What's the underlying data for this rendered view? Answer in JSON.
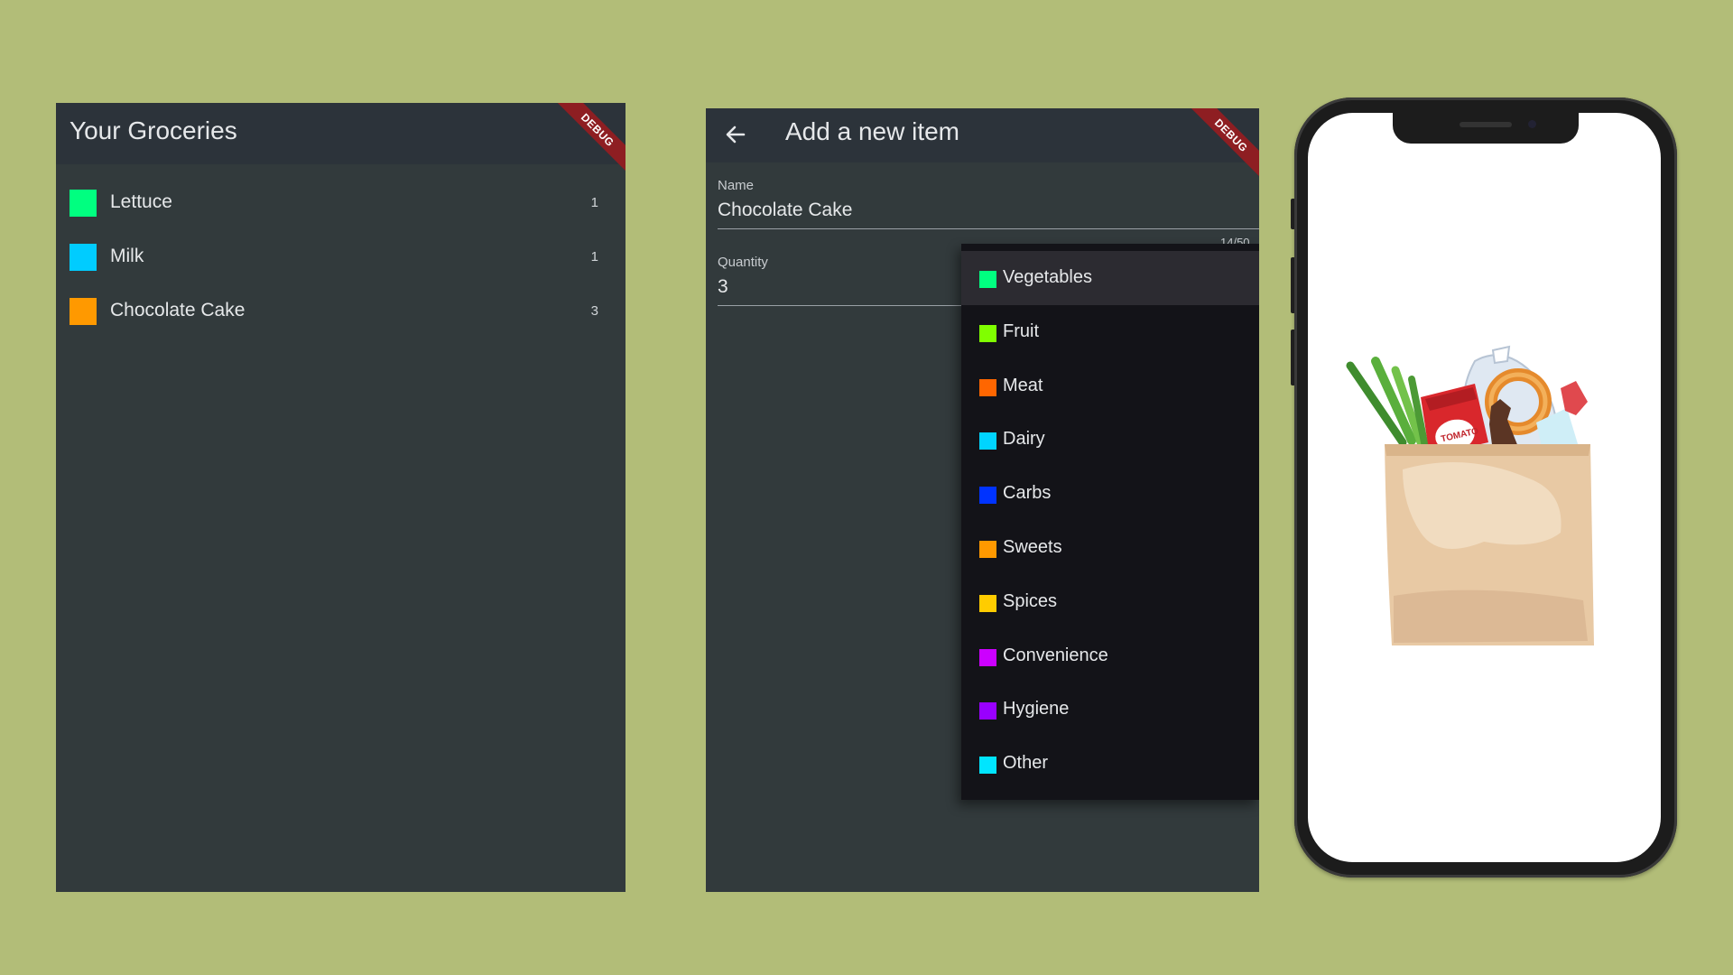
{
  "list_screen": {
    "title": "Your Groceries",
    "debug_label": "DEBUG",
    "items": [
      {
        "name": "Lettuce",
        "quantity": "1",
        "color": "#00ff80"
      },
      {
        "name": "Milk",
        "quantity": "1",
        "color": "#00ccff"
      },
      {
        "name": "Chocolate Cake",
        "quantity": "3",
        "color": "#ff9900"
      }
    ]
  },
  "form_screen": {
    "title": "Add a new item",
    "debug_label": "DEBUG",
    "name_field": {
      "label": "Name",
      "value": "Chocolate Cake",
      "counter": "14/50"
    },
    "quantity_field": {
      "label": "Quantity",
      "value": "3"
    },
    "categories": [
      {
        "label": "Vegetables",
        "color": "#00ff80",
        "selected": true
      },
      {
        "label": "Fruit",
        "color": "#80ff00"
      },
      {
        "label": "Meat",
        "color": "#ff6600"
      },
      {
        "label": "Dairy",
        "color": "#00d4ff"
      },
      {
        "label": "Carbs",
        "color": "#0033ff"
      },
      {
        "label": "Sweets",
        "color": "#ff9900"
      },
      {
        "label": "Spices",
        "color": "#ffcc00"
      },
      {
        "label": "Convenience",
        "color": "#cc00ff"
      },
      {
        "label": "Hygiene",
        "color": "#9900ff"
      },
      {
        "label": "Other",
        "color": "#00e5ff"
      }
    ]
  },
  "phone_mockup": {
    "illustration": "grocery-bag-icon",
    "bag_text": "TOMATO"
  }
}
